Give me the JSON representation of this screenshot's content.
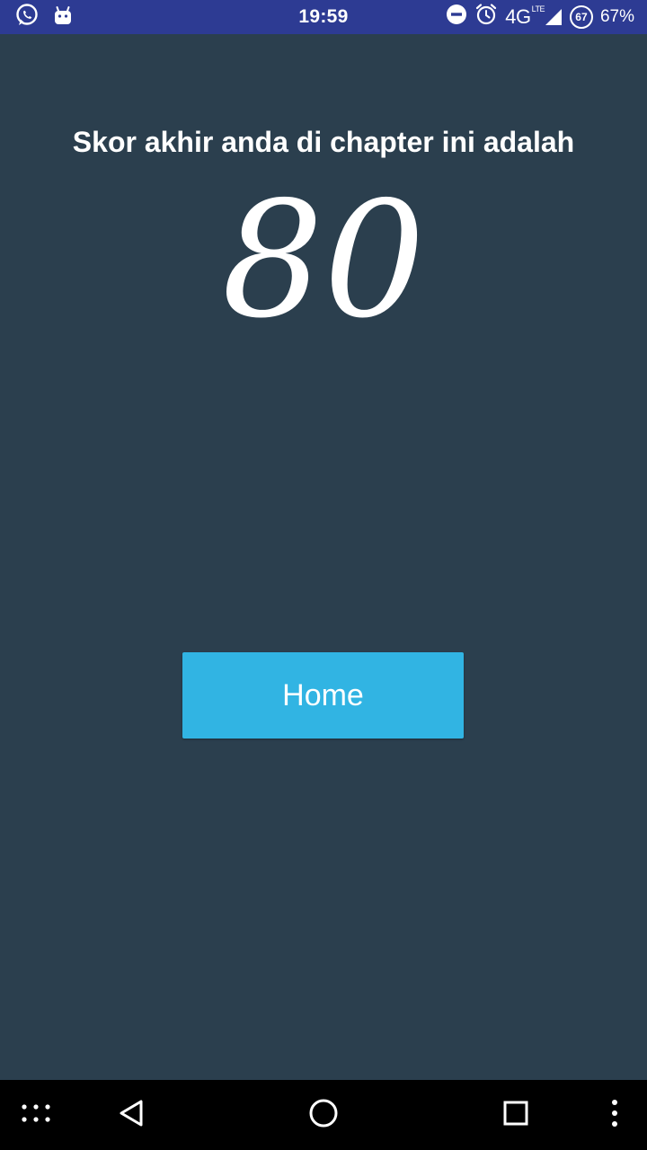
{
  "status_bar": {
    "time": "19:59",
    "network": "4G",
    "network_sub": "LTE",
    "battery_badge": "67",
    "battery_percent": "67%",
    "left_icons": [
      "whatsapp-icon",
      "android-notification-icon"
    ],
    "right_icons": [
      "do-not-disturb-icon",
      "alarm-icon",
      "signal-icon",
      "battery-circle-icon"
    ]
  },
  "result": {
    "title": "Skor akhir anda di chapter ini adalah",
    "score": "80"
  },
  "actions": {
    "home_label": "Home"
  },
  "nav_bar": {
    "icons": [
      "apps-grid-icon",
      "back-icon",
      "home-circle-icon",
      "recents-icon",
      "more-vert-icon"
    ]
  },
  "colors": {
    "background": "#2b3f4e",
    "status_bar": "#2d3b93",
    "button": "#31b4e3",
    "nav_bar": "#000000",
    "text": "#ffffff"
  }
}
